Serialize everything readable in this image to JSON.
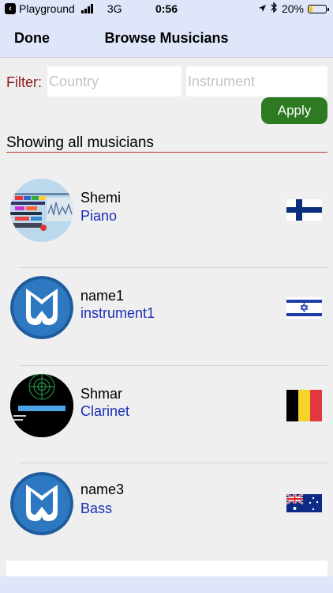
{
  "status": {
    "carrier": "Playground",
    "network": "3G",
    "time": "0:56",
    "battery": "20%",
    "battery_level": 0.2
  },
  "nav": {
    "done_label": "Done",
    "title": "Browse Musicians"
  },
  "filter": {
    "label": "Filter:",
    "country_placeholder": "Country",
    "instrument_placeholder": "Instrument",
    "apply_label": "Apply"
  },
  "list": {
    "heading": "Showing all musicians",
    "items": [
      {
        "name": "Shemi",
        "instrument": "Piano",
        "avatar": "screenshot-thumbnail",
        "flag": "finland-flag"
      },
      {
        "name": "name1",
        "instrument": "instrument1",
        "avatar": "music-app-logo",
        "flag": "israel-flag"
      },
      {
        "name": "Shmar",
        "instrument": "Clarinet",
        "avatar": "radar-screen-thumbnail",
        "flag": "belgium-flag"
      },
      {
        "name": "name3",
        "instrument": "Bass",
        "avatar": "music-app-logo",
        "flag": "australia-flag"
      }
    ]
  },
  "colors": {
    "bar": "#dfe6fa",
    "filter_label": "#8b1a1a",
    "instrument_text": "#1a2fb5",
    "apply": "#2d7a22",
    "rule": "#c0392b"
  }
}
